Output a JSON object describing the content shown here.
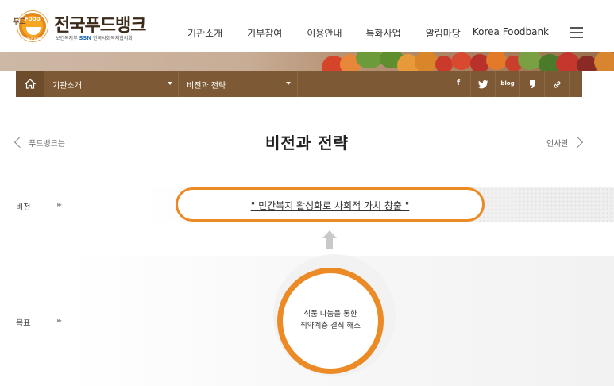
{
  "header": {
    "logo": {
      "title": "전국푸드뱅크",
      "badge_top": "FOOD",
      "badge_mid": "뱅크",
      "badge_bottom": "KOREA BANK",
      "chef_text": "푸드",
      "sub_ministry": "보건복지부",
      "sub_ssn": "SSN",
      "sub_council": "한국사회복지협의회"
    },
    "nav": [
      "기관소개",
      "기부참여",
      "이용안내",
      "특화사업",
      "알림마당",
      "Korea Foodbank"
    ],
    "menu_icon": "hamburger-icon"
  },
  "subnav": {
    "home_icon": "home-icon",
    "dropdown1": "기관소개",
    "dropdown2": "비전과 전략",
    "sns": [
      {
        "name": "facebook-icon",
        "glyph": "f"
      },
      {
        "name": "twitter-icon",
        "glyph": "🐦"
      },
      {
        "name": "blog-icon",
        "glyph": "blog"
      },
      {
        "name": "kakaostory-icon",
        "glyph": "❟"
      },
      {
        "name": "link-icon",
        "glyph": "🔗"
      }
    ]
  },
  "page": {
    "title": "비전과 전략",
    "prev_label": "푸드뱅크는",
    "next_label": "인사말"
  },
  "vision": {
    "label": "비전",
    "arrows": "▸▸",
    "text": "\" 민간복지 활성화로 사회적 가치 창출 \""
  },
  "goal": {
    "label": "목표",
    "arrows": "▸▸",
    "line1": "식품 나눔을 통한",
    "line2": "취약계층 결식 해소"
  },
  "colors": {
    "accent_orange": "#ec8a25",
    "subbar_brown": "#7d5a35"
  }
}
